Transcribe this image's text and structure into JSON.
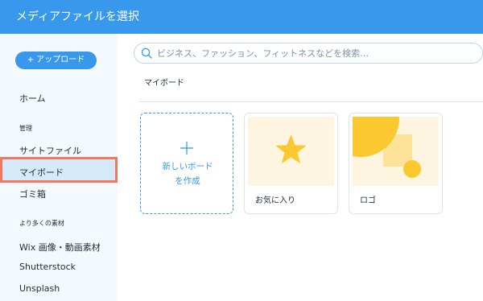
{
  "header": {
    "title": "メディアファイルを選択"
  },
  "sidebar": {
    "upload_label": "+ アップロード",
    "home": "ホーム",
    "section_manage": "管理",
    "site_files": "サイトファイル",
    "my_boards": "マイボード",
    "trash": "ゴミ箱",
    "section_more": "より多くの素材",
    "wix_media": "Wix 画像・動画素材",
    "shutterstock": "Shutterstock",
    "unsplash": "Unsplash"
  },
  "search": {
    "placeholder": "ビジネス、ファッション、フィットネスなどを検索…",
    "value": ""
  },
  "main": {
    "section_title": "マイボード",
    "new_board_line1": "新しいボード",
    "new_board_line2": "を作成",
    "boards": [
      {
        "label": "お気に入り",
        "icon": "star-icon"
      },
      {
        "label": "ロゴ",
        "icon": "shapes-icon"
      }
    ]
  },
  "colors": {
    "accent": "#3899ec",
    "sidebar_bg": "#f4f9fd",
    "highlight": "#f3775a",
    "star": "#fcc82f"
  }
}
